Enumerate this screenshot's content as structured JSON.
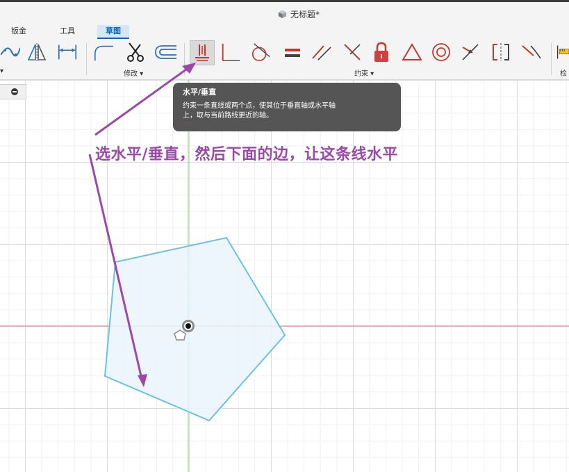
{
  "window": {
    "title": "无标题*"
  },
  "tabs": [
    {
      "label": "钣金"
    },
    {
      "label": "工具"
    },
    {
      "label": "草图",
      "active": true
    }
  ],
  "toolbar": {
    "groups": [
      {
        "label": "修改 ▾"
      },
      {
        "label": "约束 ▾"
      },
      {
        "label": "检"
      }
    ],
    "left_chevron": "▾",
    "tools": [
      {
        "icon": "spline-icon"
      },
      {
        "icon": "mirror-icon"
      },
      {
        "icon": "dimension-icon"
      },
      {
        "icon": "fillet-icon"
      },
      {
        "icon": "trim-scissors-icon"
      },
      {
        "icon": "offset-icon"
      },
      {
        "icon": "horizontal-vertical-constraint-icon",
        "highlighted": true
      },
      {
        "icon": "coincident-icon"
      },
      {
        "icon": "tangent-icon"
      },
      {
        "icon": "equal-icon"
      },
      {
        "icon": "parallel-icon"
      },
      {
        "icon": "perpendicular-icon"
      },
      {
        "icon": "fix-lock-icon"
      },
      {
        "icon": "midpoint-triangle-icon"
      },
      {
        "icon": "concentric-icon"
      },
      {
        "icon": "collinear-icon"
      },
      {
        "icon": "symmetry-icon"
      },
      {
        "icon": "curvature-icon"
      },
      {
        "icon": "inspect-ruler-icon"
      }
    ]
  },
  "tooltip": {
    "title": "水平/垂直",
    "line1": "约束一条直线或两个点，使其位于垂直轴或水平轴",
    "line2": "上，取与当前路线更近的轴。"
  },
  "annotation": {
    "text": "选水平/垂直，然后下面的边，让这条线水平"
  },
  "colors": {
    "accent": "#0a66c2",
    "annotation": "#9b49a8",
    "constraint_red": "#c0392b",
    "sketch_line": "#6cc0e0",
    "sketch_fill": "#e9f4fb",
    "x_axis": "#e07a7a",
    "y_axis": "#7fd07f"
  }
}
